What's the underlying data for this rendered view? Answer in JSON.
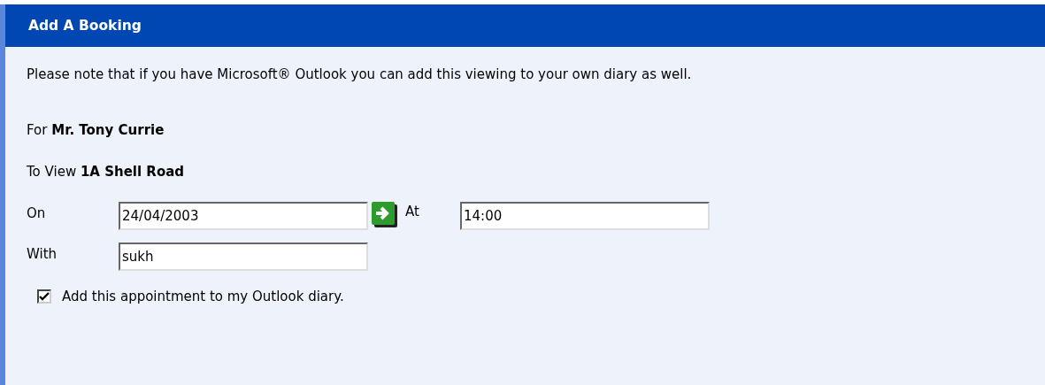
{
  "panel": {
    "title": "Add A Booking"
  },
  "note": "Please note that if you have Microsoft® Outlook you can add this viewing to your own diary as well.",
  "details": [
    {
      "label": "For",
      "value": "Mr. Tony Currie"
    },
    {
      "label": "To View",
      "value": "1A Shell Road"
    }
  ],
  "date": {
    "label": "On",
    "value": "24/04/2003"
  },
  "time": {
    "label": "At",
    "value": "14:00"
  },
  "with": {
    "label": "With",
    "value": "sukh"
  },
  "outlook": {
    "label": "Add this appointment to my Outlook diary.",
    "checked": true
  }
}
